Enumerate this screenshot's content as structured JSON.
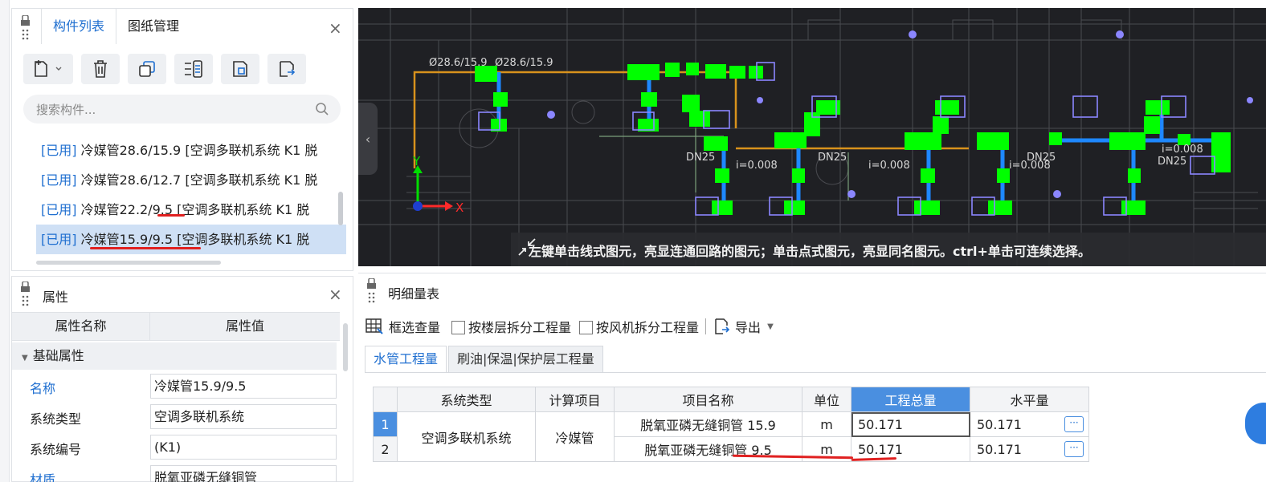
{
  "component_panel": {
    "tabs": [
      {
        "label": "构件列表",
        "active": true
      },
      {
        "label": "图纸管理",
        "active": false
      }
    ],
    "toolbar_icons": [
      "new-component-icon",
      "delete-icon",
      "copy-icon",
      "layer-copy-icon",
      "import-icon",
      "export-icon"
    ],
    "search_placeholder": "搜索构件...",
    "items": [
      {
        "tag": "[已用]",
        "text": "冷媒管28.6/15.9 [空调多联机系统 K1 脱",
        "selected": false
      },
      {
        "tag": "[已用]",
        "text": "冷媒管28.6/12.7 [空调多联机系统 K1 脱",
        "selected": false
      },
      {
        "tag": "[已用]",
        "text": "冷媒管22.2/9.5 [空调多联机系统 K1 脱",
        "selected": false
      },
      {
        "tag": "[已用]",
        "text": "冷媒管15.9/9.5 [空调多联机系统 K1 脱",
        "selected": true
      }
    ]
  },
  "properties_panel": {
    "title": "属性",
    "col_name": "属性名称",
    "col_value": "属性值",
    "group": "基础属性",
    "rows": [
      {
        "key": "名称",
        "value": "冷媒管15.9/9.5",
        "blue": true
      },
      {
        "key": "系统类型",
        "value": "空调多联机系统",
        "blue": false
      },
      {
        "key": "系统编号",
        "value": "(K1)",
        "blue": false
      },
      {
        "key": "材质",
        "value": "脱氧亚磷无缝铜管",
        "blue": true
      }
    ]
  },
  "cad_view": {
    "status_text": "左键单击线式图元，亮显连通回路的图元；单击点式图元，亮显同名图元。ctrl+单击可连续选择。",
    "axis_x": "X",
    "axis_y": "Y",
    "labels": [
      "Ø28.6/15.9",
      "Ø28.6/15.9",
      "DN25",
      "DN25",
      "DN25",
      "DN25",
      "i=0.008",
      "i=0.008",
      "i=0.008",
      "i=0.008"
    ],
    "colors": {
      "background": "#1f2024",
      "highlight": "#00ff00",
      "pipe_blue": "#1e88ff",
      "pipe_orange": "#d8921c"
    }
  },
  "detail_panel": {
    "title": "明细量表",
    "toolbar": {
      "select_query": "框选查量",
      "split_floor": "按楼层拆分工程量",
      "split_fan": "按风机拆分工程量",
      "export": "导出"
    },
    "tabs": [
      {
        "label": "水管工程量",
        "active": true
      },
      {
        "label": "刷油|保温|保护层工程量",
        "active": false
      }
    ],
    "columns": [
      "系统类型",
      "计算项目",
      "项目名称",
      "单位",
      "工程总量",
      "水平量"
    ],
    "system_type": "空调多联机系统",
    "calc_item": "冷媒管",
    "rows": [
      {
        "index": "1",
        "name": "脱氧亚磷无缝铜管 15.9",
        "unit": "m",
        "total": "50.171",
        "horizontal": "50.171"
      },
      {
        "index": "2",
        "name": "脱氧亚磷无缝铜管 9.5",
        "unit": "m",
        "total": "50.171",
        "horizontal": "50.171"
      }
    ],
    "more_button": "···"
  }
}
